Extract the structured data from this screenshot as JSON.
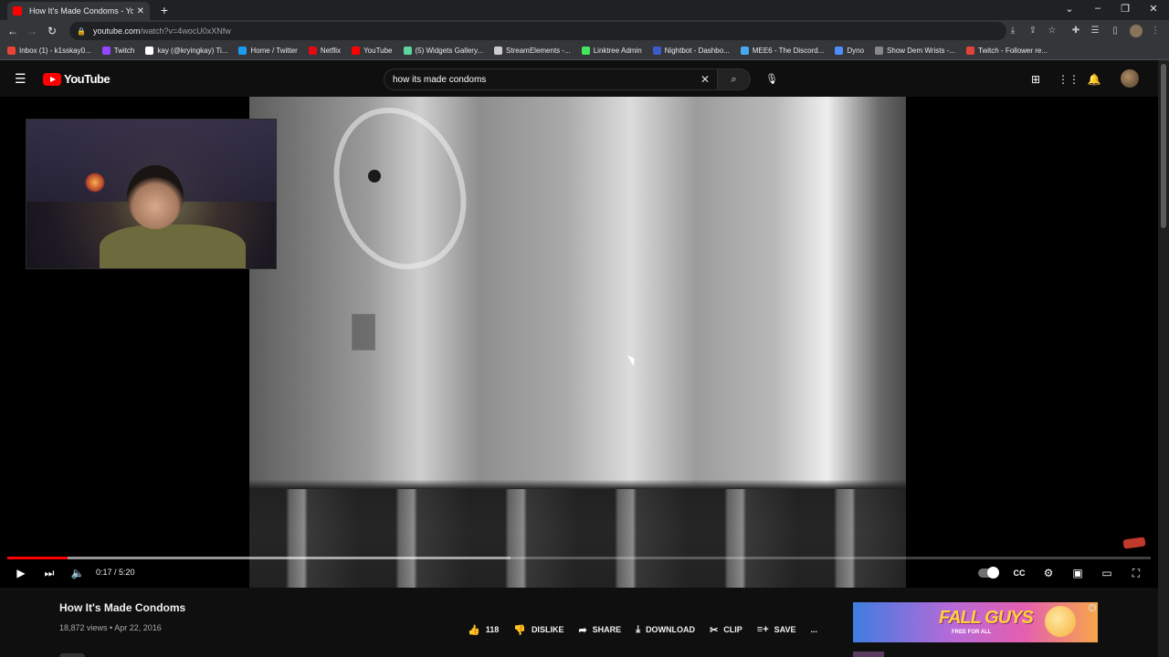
{
  "browser": {
    "tab_title": "How It's Made Condoms - YouTube",
    "new_tab": "+",
    "url_host": "youtube.com",
    "url_path": "/watch?v=4wocU0xXNfw",
    "bookmarks": [
      {
        "label": "Inbox (1) - k1sskay0...",
        "color": "#ea4335"
      },
      {
        "label": "Twitch",
        "color": "#9146ff"
      },
      {
        "label": "kay (@kryingkay) Ti...",
        "color": "#ffffff"
      },
      {
        "label": "Home / Twitter",
        "color": "#1d9bf0"
      },
      {
        "label": "Netflix",
        "color": "#e50914"
      },
      {
        "label": "YouTube",
        "color": "#ff0000"
      },
      {
        "label": "(5) Widgets Gallery...",
        "color": "#5dd39e"
      },
      {
        "label": "StreamElements -...",
        "color": "#cccccc"
      },
      {
        "label": "Linktree Admin",
        "color": "#43e55e"
      },
      {
        "label": "Nightbot - Dashbo...",
        "color": "#3b5dcc"
      },
      {
        "label": "MEE6 - The Discord...",
        "color": "#49a9f0"
      },
      {
        "label": "Dyno",
        "color": "#4e8ef7"
      },
      {
        "label": "Show Dem Wrists -...",
        "color": "#888888"
      },
      {
        "label": "Twitch - Follower re...",
        "color": "#e0443a"
      }
    ]
  },
  "youtube": {
    "logo_text": "YouTube",
    "search_value": "how its made condoms",
    "colors": {
      "accent": "#ff0000"
    }
  },
  "player": {
    "current_time": "0:17",
    "duration": "5:20",
    "time_text": "0:17 / 5:20",
    "progress_fraction": 0.053,
    "buffered_fraction": 0.44
  },
  "video": {
    "title": "How It's Made Condoms",
    "views": "18,872 views",
    "date": "Apr 22, 2016",
    "meta_text": "18,872 views • Apr 22, 2016",
    "likes": "118",
    "dislike_label": "DISLIKE",
    "share_label": "SHARE",
    "download_label": "DOWNLOAD",
    "clip_label": "CLIP",
    "save_label": "SAVE",
    "more_label": "..."
  },
  "ad": {
    "title": "FALL GUYS",
    "subtitle": "FREE FOR ALL"
  }
}
